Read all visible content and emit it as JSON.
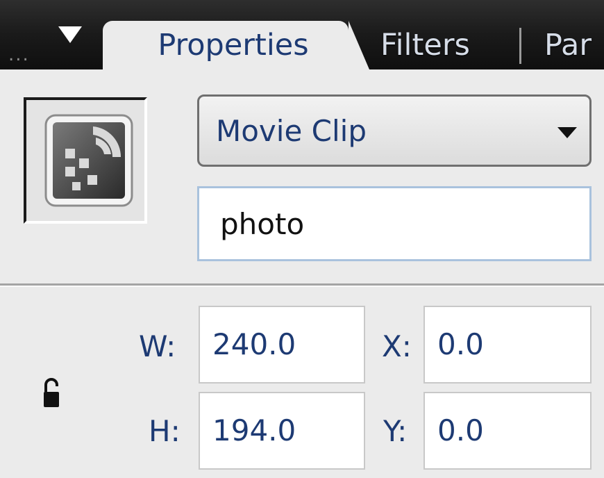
{
  "tabs": {
    "panel_menu_grip": "...",
    "active": "Properties",
    "filters": "Filters",
    "parameters_partial": "Par"
  },
  "symbol": {
    "icon": "movie-clip-gear-icon",
    "type_label": "Movie Clip",
    "type_dropdown_icon": "chevron-down-icon"
  },
  "instance": {
    "name_value": "photo",
    "name_placeholder": ""
  },
  "dimensions": {
    "w_label": "W:",
    "w_value": "240.0",
    "h_label": "H:",
    "h_value": "194.0",
    "x_label": "X:",
    "x_value": "0.0",
    "y_label": "Y:",
    "y_value": "0.0",
    "lock_icon": "unlocked-padlock-icon"
  },
  "colors": {
    "panel_bg": "#ebebeb",
    "tabbar_bg": "#1a1a1a",
    "text_blue": "#1d3a73",
    "input_focus_border": "#a9c2dd"
  }
}
